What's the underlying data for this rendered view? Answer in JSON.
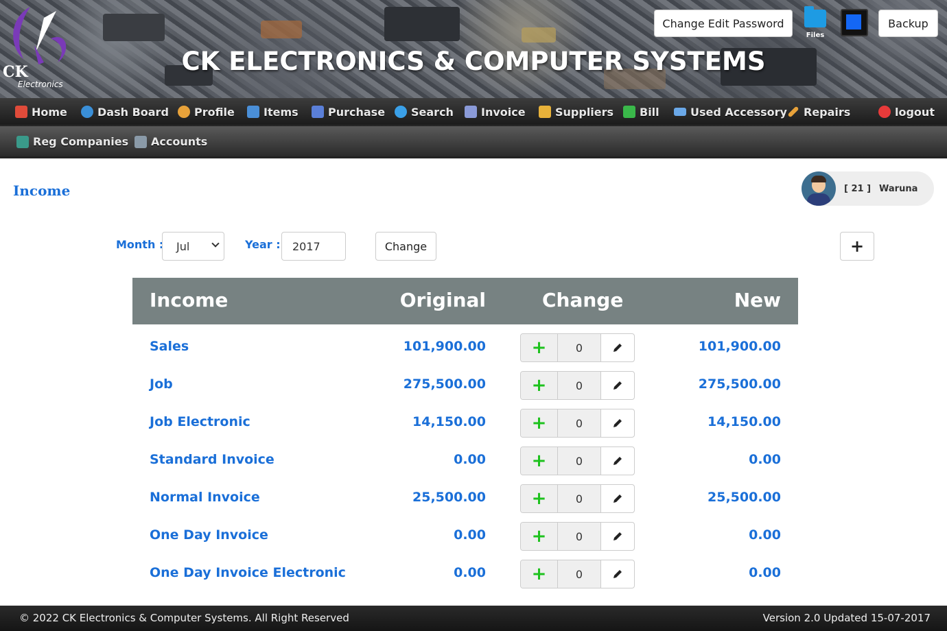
{
  "header": {
    "site_title": "CK ELECTRONICS & COMPUTER SYSTEMS",
    "logo_text_main": "CK",
    "logo_text_sub": "Electronics",
    "change_edit_password_label": "Change Edit Password",
    "files_label": "Files",
    "backup_label": "Backup"
  },
  "nav": {
    "row1": [
      {
        "label": "Home",
        "icon": "home-icon",
        "color": "#e04b3a"
      },
      {
        "label": "Dash Board",
        "icon": "dashboard-icon",
        "color": "#3a8fd8"
      },
      {
        "label": "Profile",
        "icon": "profile-icon",
        "color": "#e8a23a"
      },
      {
        "label": "Items",
        "icon": "items-icon",
        "color": "#4a8fd8"
      },
      {
        "label": "Purchase",
        "icon": "purchase-icon",
        "color": "#5a7fd8"
      },
      {
        "label": "Search",
        "icon": "search-icon",
        "color": "#3aa0e8"
      },
      {
        "label": "Invoice",
        "icon": "invoice-icon",
        "color": "#8a9ad8"
      },
      {
        "label": "Suppliers",
        "icon": "suppliers-icon",
        "color": "#e8b23a"
      },
      {
        "label": "Bill",
        "icon": "bill-icon",
        "color": "#3ab84a"
      },
      {
        "label": "Used Accessory",
        "icon": "used-accessory-icon",
        "color": "#6aa8e8"
      },
      {
        "label": "Repairs",
        "icon": "repairs-icon",
        "color": "#e8a23a"
      },
      {
        "label": "logout",
        "icon": "power-icon",
        "color": "#e83a3a"
      }
    ],
    "row2": [
      {
        "label": "Reg Companies",
        "icon": "reg-companies-icon",
        "color": "#3a9a8a"
      },
      {
        "label": "Accounts",
        "icon": "accounts-icon",
        "color": "#8a9aa8"
      }
    ]
  },
  "page": {
    "title": "Income"
  },
  "user": {
    "id_text": "[ 21 ]",
    "name": "Waruna"
  },
  "filter": {
    "month_label": "Month :",
    "month_value": "Jul",
    "year_label": "Year :",
    "year_value": "2017",
    "change_button": "Change",
    "add_button": "+"
  },
  "table": {
    "headers": {
      "income": "Income",
      "original": "Original",
      "change": "Change",
      "new": "New"
    },
    "rows": [
      {
        "name": "Sales",
        "original": "101,900.00",
        "change": "0",
        "new": "101,900.00"
      },
      {
        "name": "Job",
        "original": "275,500.00",
        "change": "0",
        "new": "275,500.00"
      },
      {
        "name": "Job Electronic",
        "original": "14,150.00",
        "change": "0",
        "new": "14,150.00"
      },
      {
        "name": "Standard Invoice",
        "original": "0.00",
        "change": "0",
        "new": "0.00"
      },
      {
        "name": "Normal Invoice",
        "original": "25,500.00",
        "change": "0",
        "new": "25,500.00"
      },
      {
        "name": "One Day Invoice",
        "original": "0.00",
        "change": "0",
        "new": "0.00"
      },
      {
        "name": "One Day Invoice Electronic",
        "original": "0.00",
        "change": "0",
        "new": "0.00"
      }
    ]
  },
  "footer": {
    "copyright": "© 2022  CK Electronics & Computer Systems. All Right Reserved",
    "version": "Version 2.0 Updated 15-07-2017"
  },
  "colors": {
    "accent_blue": "#1a6fd8",
    "table_header": "#778282",
    "plus_green": "#1ec21e"
  }
}
